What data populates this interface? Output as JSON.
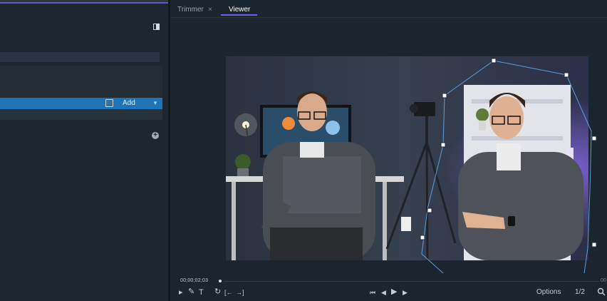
{
  "tabs": {
    "trimmer": "Trimmer",
    "trimmer_close": "×",
    "viewer": "Viewer"
  },
  "left_panel": {
    "add_label": "Add",
    "add_caret": "▼",
    "add_circle": "+"
  },
  "timeline": {
    "timecode": "00;00;02;03",
    "timecode_end": "00"
  },
  "toolbar": {
    "options_label": "Options",
    "zoom_label": "1/2",
    "tools": {
      "select": "▸",
      "pen": "✎",
      "text": "T",
      "loop": "↻",
      "mark_in": "[←",
      "mark_out": "→]",
      "to_start": "⏮",
      "step_back": "◀",
      "play": "▶",
      "step_forward": "▶"
    }
  },
  "icons": [
    "panel-toggle-icon",
    "add-circle-icon",
    "search-icon",
    "play-icon",
    "loop-icon"
  ],
  "colors": {
    "accent": "#6c63e4",
    "selection": "#1f74b8",
    "mask_outline": "#5a9fe0"
  }
}
